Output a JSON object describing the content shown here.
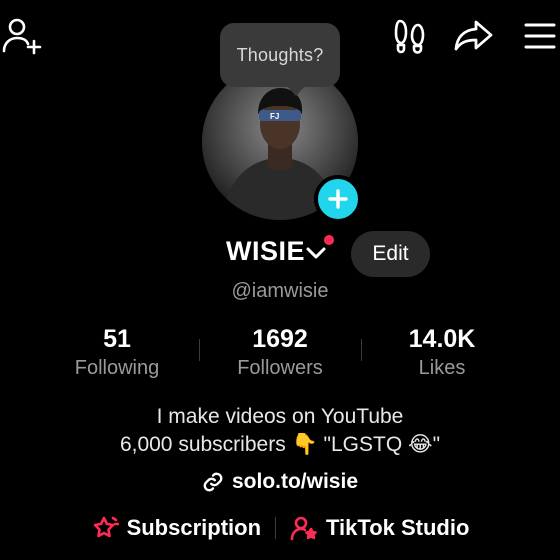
{
  "tooltip": {
    "text": "Thoughts?"
  },
  "profile": {
    "display_name": "WISIE",
    "handle": "@iamwisie",
    "edit_label": "Edit",
    "has_notification_dot": true
  },
  "stats": [
    {
      "value": "51",
      "label": "Following"
    },
    {
      "value": "1692",
      "label": "Followers"
    },
    {
      "value": "14.0K",
      "label": "Likes"
    }
  ],
  "bio": {
    "line1": "I make videos on YouTube",
    "line2_text": "6,000 subscribers",
    "line2_emoji1": "👇",
    "line2_quote": "\"LGSTQ",
    "line2_emoji2": "😂",
    "line2_end": "\""
  },
  "link": {
    "url": "solo.to/wisie"
  },
  "bottom": {
    "subscription_label": "Subscription",
    "studio_label": "TikTok Studio"
  },
  "icons": {
    "top_left": "add-friend-icon",
    "top_right": [
      "footprints-icon",
      "share-icon",
      "menu-icon"
    ]
  },
  "colors": {
    "accent_cyan": "#20d5ec",
    "accent_red": "#fe2c55",
    "muted_text": "#9a9a9a"
  }
}
